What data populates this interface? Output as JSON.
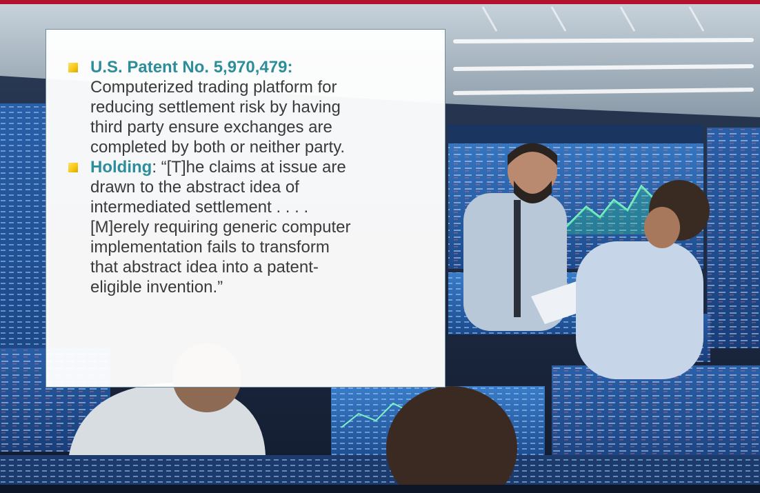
{
  "slide": {
    "bullets": [
      {
        "emphasis": "U.S. Patent No. 5,970,479:",
        "after_emphasis": "",
        "lines": [
          "Computerized trading platform for",
          "reducing settlement risk by having",
          "third party ensure exchanges are",
          "completed by both or neither party."
        ]
      },
      {
        "emphasis": "Holding",
        "after_emphasis": ": “[T]he claims at issue are",
        "lines": [
          "drawn to the abstract idea of",
          "intermediated settlement . . . .",
          "[M]erely requiring generic computer",
          "implementation fails to transform",
          "that abstract idea into a patent-",
          "eligible invention.”"
        ]
      }
    ],
    "colors": {
      "accent_bar": "#b3122f",
      "emphasis_text": "#2c8e9a",
      "bullet_square": "#f6c915",
      "body_text": "#3a3a3a"
    },
    "background_image": "trading-floor-photo"
  }
}
